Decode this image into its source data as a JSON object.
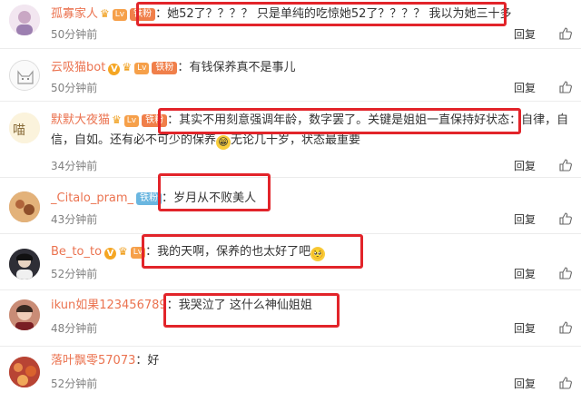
{
  "comments": [
    {
      "user": "孤寡家人",
      "level": "Lv",
      "fan_badge": "铁粉",
      "colon": "：",
      "text": "她52了？？？？ 只是单纯的吃惊她52了？？？？ 我以为她三十多",
      "time": "50分钟前",
      "reply": "回复",
      "like_icon": "thumb-up-icon"
    },
    {
      "user": "云吸猫bot",
      "v_badge": "V",
      "level": "Lv",
      "fan_badge": "铁粉",
      "colon": "：",
      "text": "有钱保养真不是事儿",
      "time": "50分钟前",
      "reply": "回复",
      "like_icon": "thumb-up-icon"
    },
    {
      "user": "默默大夜猫",
      "level": "Lv",
      "fan_badge": "铁粉",
      "colon": "：",
      "text_a": "其实不用刻意强调年龄，数字罢了。关键是姐姐一直保持好状态：自律，自信，自如。还有必不可少的保养",
      "text_b": "无论几十岁，状态最重要",
      "time": "34分钟前",
      "reply": "回复",
      "like_icon": "thumb-up-icon"
    },
    {
      "user": "_Citalo_pram_",
      "fan_badge": "铁粉",
      "colon": "：",
      "text": "岁月从不败美人",
      "time": "43分钟前",
      "reply": "回复",
      "like_icon": "thumb-up-icon"
    },
    {
      "user": "Be_to_to",
      "v_badge": "V",
      "level": "Lv",
      "colon": "：",
      "text": "我的天啊，保养的也太好了吧",
      "time": "52分钟前",
      "reply": "回复",
      "like_icon": "thumb-up-icon"
    },
    {
      "user": "ikun如果123456789",
      "colon": "：",
      "text": "我哭泣了 这什么神仙姐姐",
      "time": "48分钟前",
      "reply": "回复",
      "like_icon": "thumb-up-icon"
    },
    {
      "user": "落叶飘零57073",
      "colon": "：",
      "text": "好",
      "time": "52分钟前",
      "reply": "回复",
      "like_icon": "thumb-up-icon"
    }
  ],
  "colors": {
    "username": "#eb7350",
    "highlight_box": "#e2242a",
    "time": "#808080",
    "divider": "#ececec"
  }
}
